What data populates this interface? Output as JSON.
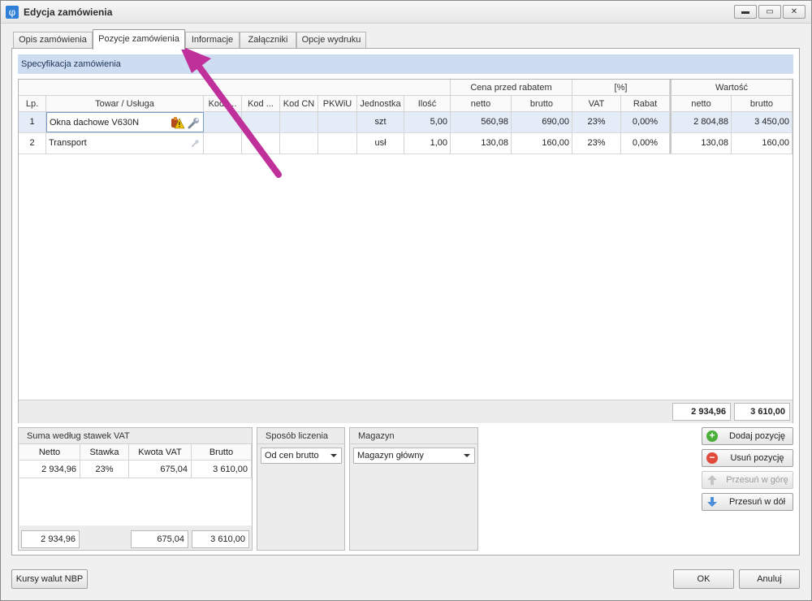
{
  "window": {
    "title": "Edycja zamówienia",
    "app_icon_glyph": "φ",
    "buttons": {
      "minimize": "▬",
      "maximize": "▭",
      "close": "✕"
    }
  },
  "tabs": [
    {
      "label": "Opis zamówienia"
    },
    {
      "label": "Pozycje zamówienia",
      "active": true
    },
    {
      "label": "Informacje"
    },
    {
      "label": "Załączniki"
    },
    {
      "label": "Opcje wydruku"
    }
  ],
  "section": {
    "title": "Specyfikacja zamówienia"
  },
  "grid": {
    "band_headers": {
      "price_before_discount": "Cena przed rabatem",
      "percent": "[%]",
      "value": "Wartość"
    },
    "columns": {
      "lp": "Lp.",
      "product": "Towar / Usługa",
      "code1": "Kod t...",
      "code2": "Kod ...",
      "code_cn": "Kod CN",
      "pkwiu": "PKWiU",
      "unit": "Jednostka",
      "qty": "Ilość",
      "net": "netto",
      "gross": "brutto",
      "vat": "VAT",
      "discount": "Rabat",
      "value_net": "netto",
      "value_gross": "brutto"
    },
    "rows": [
      {
        "lp": "1",
        "product": "Okna dachowe V630N",
        "unit": "szt",
        "qty": "5,00",
        "net": "560,98",
        "gross": "690,00",
        "vat": "23%",
        "discount": "0,00%",
        "value_net": "2 804,88",
        "value_gross": "3 450,00"
      },
      {
        "lp": "2",
        "product": "Transport",
        "unit": "usł",
        "qty": "1,00",
        "net": "130,08",
        "gross": "160,00",
        "vat": "23%",
        "discount": "0,00%",
        "value_net": "130,08",
        "value_gross": "160,00"
      }
    ],
    "totals": {
      "net": "2 934,96",
      "gross": "3 610,00"
    }
  },
  "vat_summary": {
    "title": "Suma według stawek VAT",
    "headers": [
      "Netto",
      "Stawka",
      "Kwota VAT",
      "Brutto"
    ],
    "rows": [
      {
        "netto": "2 934,96",
        "stawka": "23%",
        "kwota_vat": "675,04",
        "brutto": "3 610,00"
      }
    ],
    "totals": {
      "netto": "2 934,96",
      "kwota_vat": "675,04",
      "brutto": "3 610,00"
    }
  },
  "calc_method": {
    "title": "Sposób liczenia",
    "value": "Od cen brutto"
  },
  "warehouse": {
    "title": "Magazyn",
    "value": "Magazyn główny"
  },
  "actions": {
    "add": "Dodaj pozycję",
    "remove": "Usuń pozycję",
    "move_up": "Przesuń w górę",
    "move_down": "Przesuń w dół"
  },
  "footer": {
    "nbp": "Kursy walut NBP",
    "ok": "OK",
    "cancel": "Anuluj"
  },
  "colors": {
    "annotation_arrow": "#c0309a",
    "section_header_bg": "#cddcf0",
    "selected_row": "#e4ecf8"
  }
}
